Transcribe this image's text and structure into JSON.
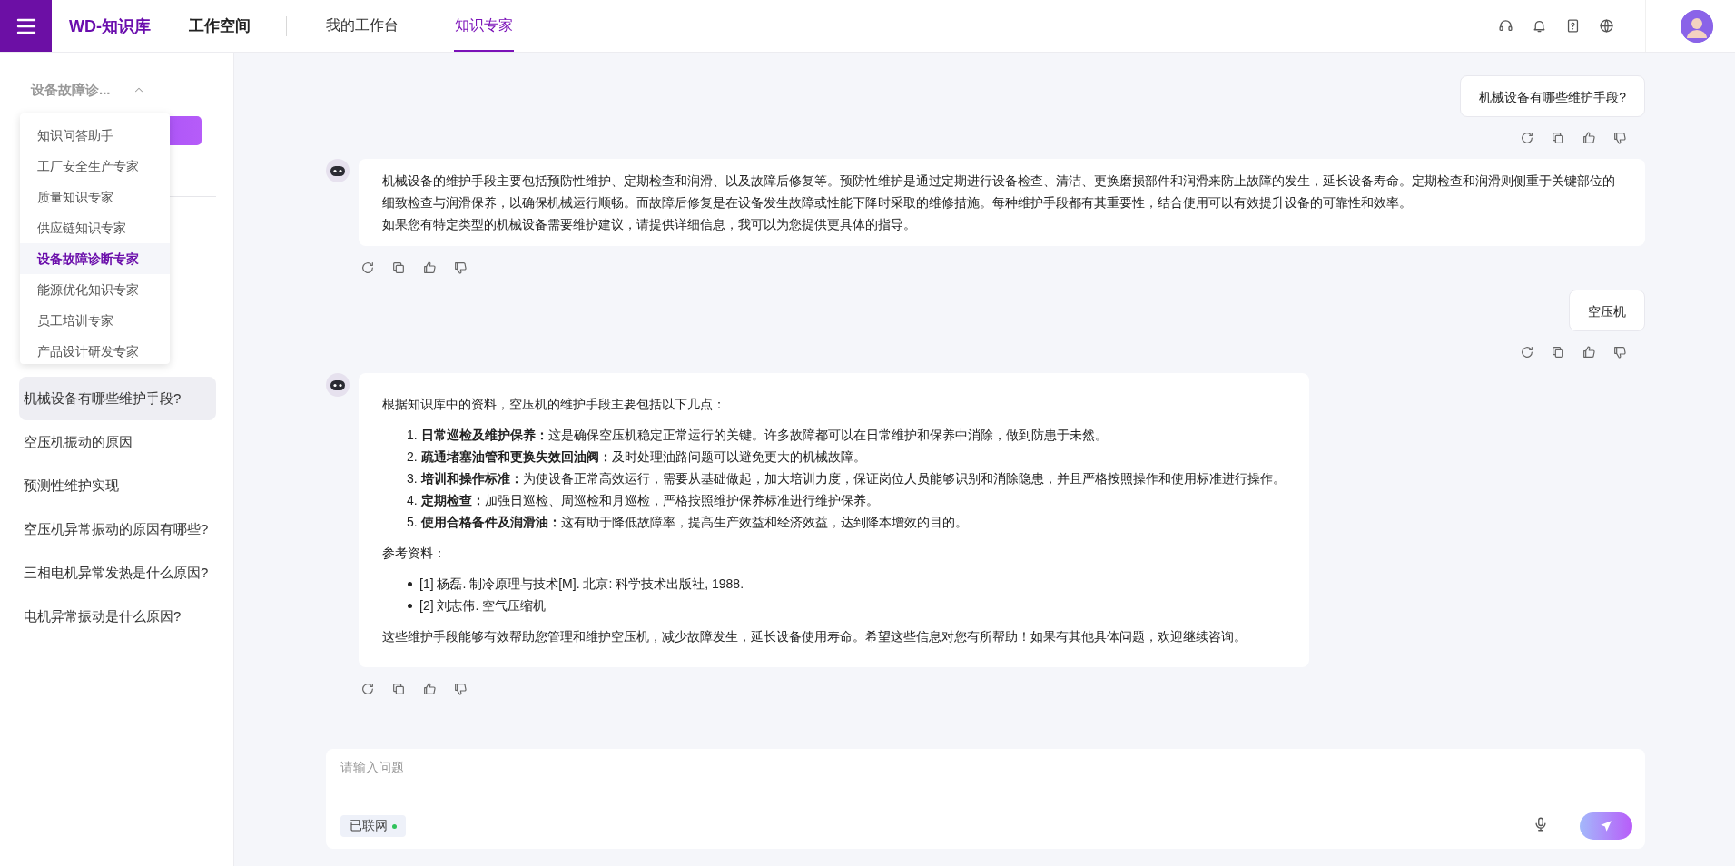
{
  "header": {
    "logo": "WD-知识库",
    "workspace": "工作空间",
    "nav": [
      {
        "label": "我的工作台",
        "selected": false
      },
      {
        "label": "知识专家",
        "selected": true
      }
    ]
  },
  "sidebar": {
    "expert_select": "设备故障诊...",
    "expert_menu": [
      {
        "label": "知识问答助手",
        "selected": false
      },
      {
        "label": "工厂安全生产专家",
        "selected": false
      },
      {
        "label": "质量知识专家",
        "selected": false
      },
      {
        "label": "供应链知识专家",
        "selected": false
      },
      {
        "label": "设备故障诊断专家",
        "selected": true
      },
      {
        "label": "能源优化知识专家",
        "selected": false
      },
      {
        "label": "员工培训专家",
        "selected": false
      },
      {
        "label": "产品设计研发专家",
        "selected": false
      }
    ],
    "history": [
      {
        "label": "机械设备有哪些维护手段?",
        "selected": true
      },
      {
        "label": "空压机振动的原因",
        "selected": false
      },
      {
        "label": "预测性维护实现",
        "selected": false
      },
      {
        "label": "空压机异常振动的原因有哪些?",
        "selected": false
      },
      {
        "label": "三相电机异常发热是什么原因?",
        "selected": false
      },
      {
        "label": "电机异常振动是什么原因?",
        "selected": false
      }
    ]
  },
  "chat": {
    "messages": [
      {
        "kind": "user",
        "text": "机械设备有哪些维护手段?"
      },
      {
        "kind": "assistant",
        "blocks": [
          {
            "kind": "paragraph",
            "text": "机械设备的维护手段主要包括预防性维护、定期检查和润滑、以及故障后修复等。预防性维护是通过定期进行设备检查、清洁、更换磨损部件和润滑来防止故障的发生，延长设备寿命。定期检查和润滑则侧重于关键部位的细致检查与润滑保养，以确保机械运行顺畅。而故障后修复是在设备发生故障或性能下降时采取的维修措施。每种维护手段都有其重要性，结合使用可以有效提升设备的可靠性和效率。"
          },
          {
            "kind": "line",
            "text": "如果您有特定类型的机械设备需要维护建议，请提供详细信息，我可以为您提供更具体的指导。"
          }
        ]
      },
      {
        "kind": "user",
        "text": "空压机"
      },
      {
        "kind": "assistant",
        "blocks": [
          {
            "kind": "paragraph",
            "text": "根据知识库中的资料，空压机的维护手段主要包括以下几点："
          },
          {
            "kind": "ordered",
            "items": [
              {
                "number": "1.",
                "text": "**日常巡检及维护保养：**这是确保空压机稳定正常运行的关键。许多故障都可以在日常维护和保养中消除，做到防患于未然。"
              },
              {
                "number": "2.",
                "text": "**疏通堵塞油管和更换失效回油阀：**及时处理油路问题可以避免更大的机械故障。"
              },
              {
                "number": "3.",
                "text": "**培训和操作标准：**为使设备正常高效运行，需要从基础做起，加大培训力度，保证岗位人员能够识别和消除隐患，并且严格按照操作和使用标准进行操作。"
              },
              {
                "number": "4.",
                "text": "**定期检查：**加强日巡检、周巡检和月巡检，严格按照维护保养标准进行维护保养。"
              },
              {
                "number": "5.",
                "text": "**使用合格备件及润滑油：**这有助于降低故障率，提高生产效益和经济效益，达到降本增效的目的。"
              }
            ]
          },
          {
            "kind": "paragraph",
            "text": "参考资料："
          },
          {
            "kind": "bullets",
            "items": [
              {
                "text": "[1] 杨磊. 制冷原理与技术[M]. 北京: 科学技术出版社, 1988."
              },
              {
                "text": "[2] 刘志伟. 空气压缩机"
              }
            ]
          },
          {
            "kind": "paragraph",
            "text": "这些维护手段能够有效帮助您管理和维护空压机，减少故障发生，延长设备使用寿命。希望这些信息对您有所帮助！如果有其他具体问题，欢迎继续咨询。"
          }
        ]
      }
    ]
  },
  "composer": {
    "placeholder": "请输入问题",
    "network_tag": "已联网",
    "connected": true
  }
}
